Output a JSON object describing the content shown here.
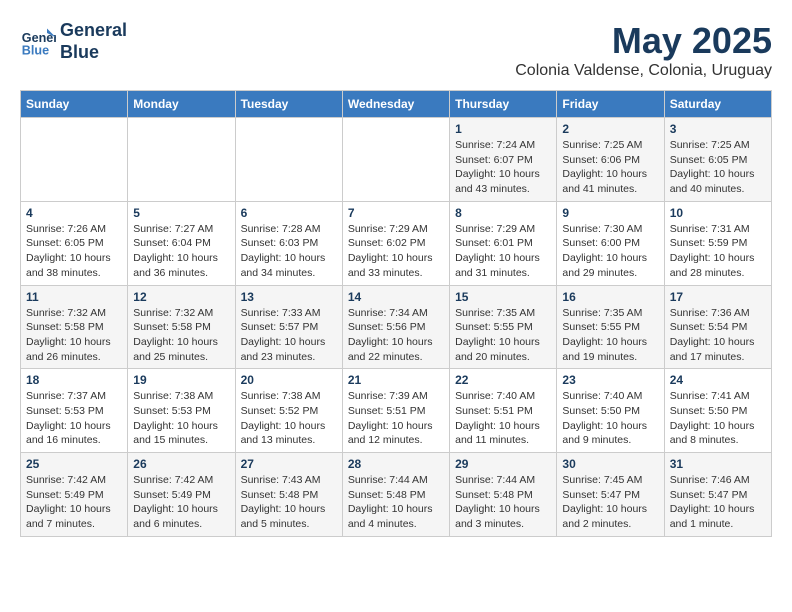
{
  "header": {
    "logo_line1": "General",
    "logo_line2": "Blue",
    "month": "May 2025",
    "location": "Colonia Valdense, Colonia, Uruguay"
  },
  "weekdays": [
    "Sunday",
    "Monday",
    "Tuesday",
    "Wednesday",
    "Thursday",
    "Friday",
    "Saturday"
  ],
  "weeks": [
    [
      {
        "day": "",
        "info": ""
      },
      {
        "day": "",
        "info": ""
      },
      {
        "day": "",
        "info": ""
      },
      {
        "day": "",
        "info": ""
      },
      {
        "day": "1",
        "info": "Sunrise: 7:24 AM\nSunset: 6:07 PM\nDaylight: 10 hours\nand 43 minutes."
      },
      {
        "day": "2",
        "info": "Sunrise: 7:25 AM\nSunset: 6:06 PM\nDaylight: 10 hours\nand 41 minutes."
      },
      {
        "day": "3",
        "info": "Sunrise: 7:25 AM\nSunset: 6:05 PM\nDaylight: 10 hours\nand 40 minutes."
      }
    ],
    [
      {
        "day": "4",
        "info": "Sunrise: 7:26 AM\nSunset: 6:05 PM\nDaylight: 10 hours\nand 38 minutes."
      },
      {
        "day": "5",
        "info": "Sunrise: 7:27 AM\nSunset: 6:04 PM\nDaylight: 10 hours\nand 36 minutes."
      },
      {
        "day": "6",
        "info": "Sunrise: 7:28 AM\nSunset: 6:03 PM\nDaylight: 10 hours\nand 34 minutes."
      },
      {
        "day": "7",
        "info": "Sunrise: 7:29 AM\nSunset: 6:02 PM\nDaylight: 10 hours\nand 33 minutes."
      },
      {
        "day": "8",
        "info": "Sunrise: 7:29 AM\nSunset: 6:01 PM\nDaylight: 10 hours\nand 31 minutes."
      },
      {
        "day": "9",
        "info": "Sunrise: 7:30 AM\nSunset: 6:00 PM\nDaylight: 10 hours\nand 29 minutes."
      },
      {
        "day": "10",
        "info": "Sunrise: 7:31 AM\nSunset: 5:59 PM\nDaylight: 10 hours\nand 28 minutes."
      }
    ],
    [
      {
        "day": "11",
        "info": "Sunrise: 7:32 AM\nSunset: 5:58 PM\nDaylight: 10 hours\nand 26 minutes."
      },
      {
        "day": "12",
        "info": "Sunrise: 7:32 AM\nSunset: 5:58 PM\nDaylight: 10 hours\nand 25 minutes."
      },
      {
        "day": "13",
        "info": "Sunrise: 7:33 AM\nSunset: 5:57 PM\nDaylight: 10 hours\nand 23 minutes."
      },
      {
        "day": "14",
        "info": "Sunrise: 7:34 AM\nSunset: 5:56 PM\nDaylight: 10 hours\nand 22 minutes."
      },
      {
        "day": "15",
        "info": "Sunrise: 7:35 AM\nSunset: 5:55 PM\nDaylight: 10 hours\nand 20 minutes."
      },
      {
        "day": "16",
        "info": "Sunrise: 7:35 AM\nSunset: 5:55 PM\nDaylight: 10 hours\nand 19 minutes."
      },
      {
        "day": "17",
        "info": "Sunrise: 7:36 AM\nSunset: 5:54 PM\nDaylight: 10 hours\nand 17 minutes."
      }
    ],
    [
      {
        "day": "18",
        "info": "Sunrise: 7:37 AM\nSunset: 5:53 PM\nDaylight: 10 hours\nand 16 minutes."
      },
      {
        "day": "19",
        "info": "Sunrise: 7:38 AM\nSunset: 5:53 PM\nDaylight: 10 hours\nand 15 minutes."
      },
      {
        "day": "20",
        "info": "Sunrise: 7:38 AM\nSunset: 5:52 PM\nDaylight: 10 hours\nand 13 minutes."
      },
      {
        "day": "21",
        "info": "Sunrise: 7:39 AM\nSunset: 5:51 PM\nDaylight: 10 hours\nand 12 minutes."
      },
      {
        "day": "22",
        "info": "Sunrise: 7:40 AM\nSunset: 5:51 PM\nDaylight: 10 hours\nand 11 minutes."
      },
      {
        "day": "23",
        "info": "Sunrise: 7:40 AM\nSunset: 5:50 PM\nDaylight: 10 hours\nand 9 minutes."
      },
      {
        "day": "24",
        "info": "Sunrise: 7:41 AM\nSunset: 5:50 PM\nDaylight: 10 hours\nand 8 minutes."
      }
    ],
    [
      {
        "day": "25",
        "info": "Sunrise: 7:42 AM\nSunset: 5:49 PM\nDaylight: 10 hours\nand 7 minutes."
      },
      {
        "day": "26",
        "info": "Sunrise: 7:42 AM\nSunset: 5:49 PM\nDaylight: 10 hours\nand 6 minutes."
      },
      {
        "day": "27",
        "info": "Sunrise: 7:43 AM\nSunset: 5:48 PM\nDaylight: 10 hours\nand 5 minutes."
      },
      {
        "day": "28",
        "info": "Sunrise: 7:44 AM\nSunset: 5:48 PM\nDaylight: 10 hours\nand 4 minutes."
      },
      {
        "day": "29",
        "info": "Sunrise: 7:44 AM\nSunset: 5:48 PM\nDaylight: 10 hours\nand 3 minutes."
      },
      {
        "day": "30",
        "info": "Sunrise: 7:45 AM\nSunset: 5:47 PM\nDaylight: 10 hours\nand 2 minutes."
      },
      {
        "day": "31",
        "info": "Sunrise: 7:46 AM\nSunset: 5:47 PM\nDaylight: 10 hours\nand 1 minute."
      }
    ]
  ]
}
